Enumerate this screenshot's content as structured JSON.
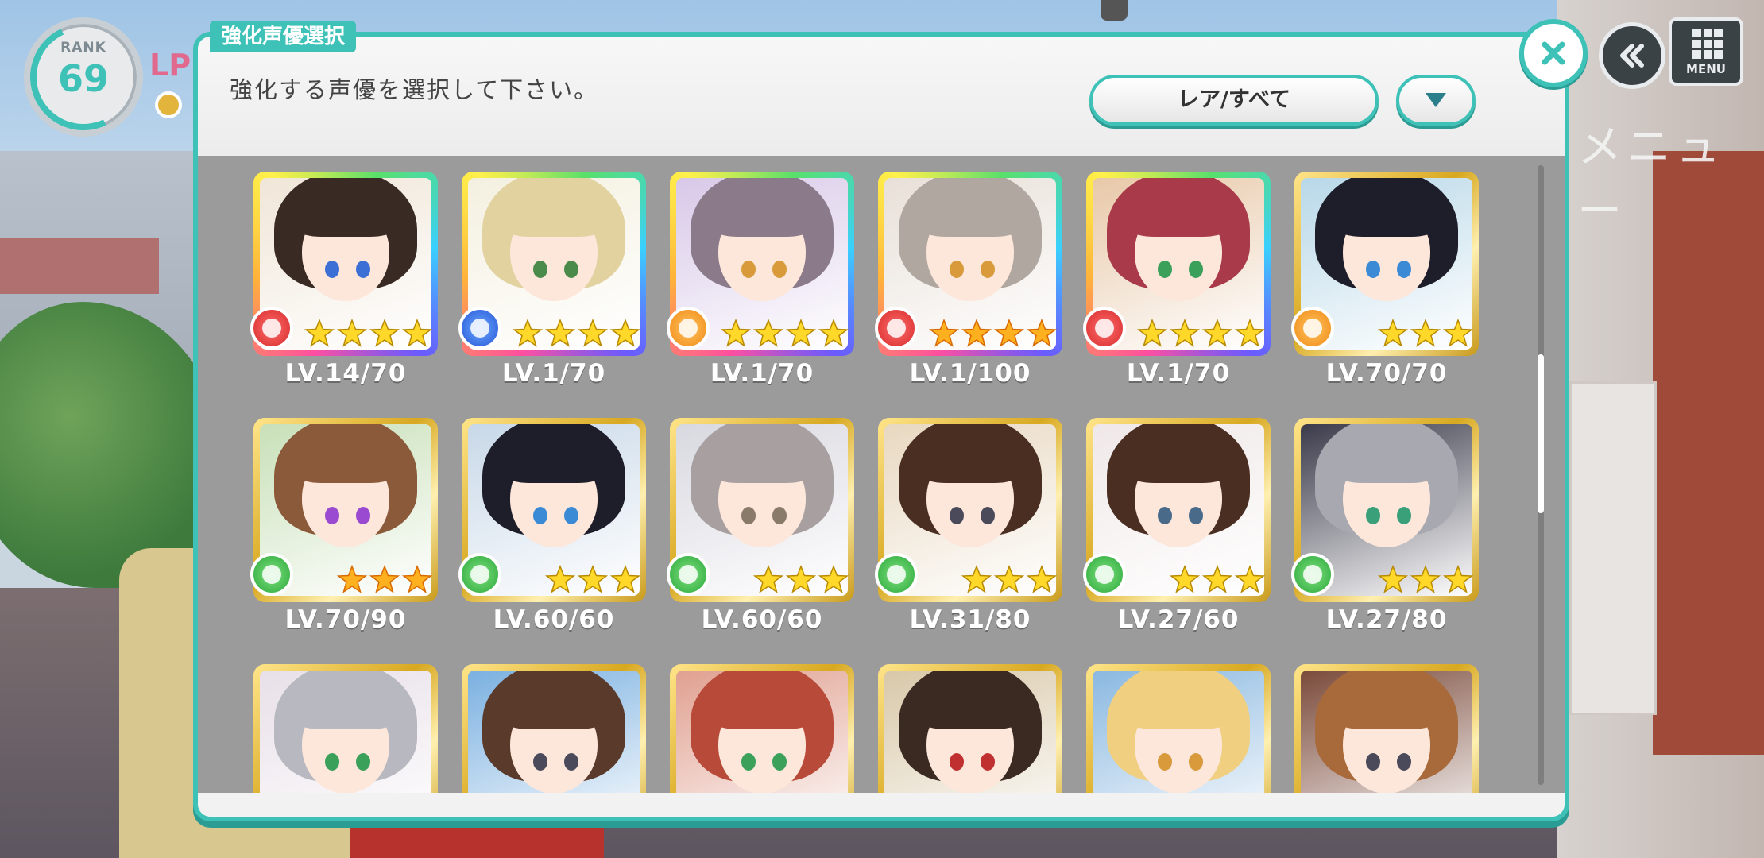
{
  "hud": {
    "rank_label": "RANK",
    "rank_value": "69",
    "lp_label": "LP",
    "menu_label": "MENU",
    "bg_menu_text": "メニュー"
  },
  "dialog": {
    "title": "強化声優選択",
    "subtitle": "強化する声優を選択して下さい。",
    "filter_label": "レア/すべて"
  },
  "colors": {
    "accent": "#3ec1b7",
    "accent_dark": "#2a9c93",
    "body_bg": "#9b9b9b"
  },
  "cards": [
    {
      "level": "LV.14/70",
      "frame": "rainbow",
      "attr": "red",
      "stars": 4,
      "star_type": "gold",
      "hair": "#3a2a24",
      "eye": "#3b6fd6",
      "bg": "#f0e6d8"
    },
    {
      "level": "LV.1/70",
      "frame": "rainbow",
      "attr": "blue",
      "stars": 4,
      "star_type": "gold",
      "hair": "#e2d2a0",
      "eye": "#4a8a4a",
      "bg": "#f4f0e0"
    },
    {
      "level": "LV.1/70",
      "frame": "rainbow",
      "attr": "orange",
      "stars": 4,
      "star_type": "gold",
      "hair": "#8a7a8a",
      "eye": "#d89a3a",
      "bg": "#d8c8e8"
    },
    {
      "level": "LV.1/100",
      "frame": "rainbow",
      "attr": "red",
      "stars": 4,
      "star_type": "sun",
      "hair": "#b0a8a0",
      "eye": "#d89a3a",
      "bg": "#e8e0d8"
    },
    {
      "level": "LV.1/70",
      "frame": "rainbow",
      "attr": "red",
      "stars": 4,
      "star_type": "gold",
      "hair": "#a83a4a",
      "eye": "#3aa05a",
      "bg": "#e8c8a8"
    },
    {
      "level": "LV.70/70",
      "frame": "gold",
      "attr": "orange",
      "stars": 3,
      "star_type": "gold",
      "hair": "#1e1e2a",
      "eye": "#3a8ad6",
      "bg": "#b8d8e8"
    },
    {
      "level": "LV.70/90",
      "frame": "gold",
      "attr": "green",
      "stars": 3,
      "star_type": "sun",
      "hair": "#8a5a3a",
      "eye": "#9a4ad0",
      "bg": "#c8e0b8"
    },
    {
      "level": "LV.60/60",
      "frame": "gold",
      "attr": "green",
      "stars": 3,
      "star_type": "gold",
      "hair": "#1e1e2a",
      "eye": "#3a8ad6",
      "bg": "#c8d8e8"
    },
    {
      "level": "LV.60/60",
      "frame": "gold",
      "attr": "green",
      "stars": 3,
      "star_type": "gold",
      "hair": "#a8a0a0",
      "eye": "#8a7a6a",
      "bg": "#d8d8e0"
    },
    {
      "level": "LV.31/80",
      "frame": "gold",
      "attr": "green",
      "stars": 3,
      "star_type": "gold",
      "hair": "#4a2e22",
      "eye": "#4a4a5a",
      "bg": "#e8d8c0"
    },
    {
      "level": "LV.27/60",
      "frame": "gold",
      "attr": "green",
      "stars": 3,
      "star_type": "gold",
      "hair": "#4a2e22",
      "eye": "#4a6a8a",
      "bg": "#f0e8e8"
    },
    {
      "level": "LV.27/80",
      "frame": "gold",
      "attr": "green",
      "stars": 3,
      "star_type": "gold",
      "hair": "#a8a8b0",
      "eye": "#3aa07a",
      "bg": "#3a3a4a"
    },
    {
      "level": "",
      "frame": "gold",
      "attr": "",
      "stars": 0,
      "star_type": "gold",
      "hair": "#b8b8c0",
      "eye": "#3aa05a",
      "bg": "#e8e0e8"
    },
    {
      "level": "",
      "frame": "gold",
      "attr": "",
      "stars": 0,
      "star_type": "gold",
      "hair": "#5a3a2a",
      "eye": "#4a4a5a",
      "bg": "#7ab0e0"
    },
    {
      "level": "",
      "frame": "gold",
      "attr": "",
      "stars": 0,
      "star_type": "gold",
      "hair": "#b84a3a",
      "eye": "#3aa05a",
      "bg": "#e0a090"
    },
    {
      "level": "",
      "frame": "gold",
      "attr": "",
      "stars": 0,
      "star_type": "gold",
      "hair": "#3a2a22",
      "eye": "#c03030",
      "bg": "#d8c8a8"
    },
    {
      "level": "",
      "frame": "gold",
      "attr": "",
      "stars": 0,
      "star_type": "gold",
      "hair": "#f0d080",
      "eye": "#d89a3a",
      "bg": "#8ab8e0"
    },
    {
      "level": "",
      "frame": "gold",
      "attr": "",
      "stars": 0,
      "star_type": "gold",
      "hair": "#a86a3a",
      "eye": "#4a4a5a",
      "bg": "#7a4a3a"
    }
  ]
}
